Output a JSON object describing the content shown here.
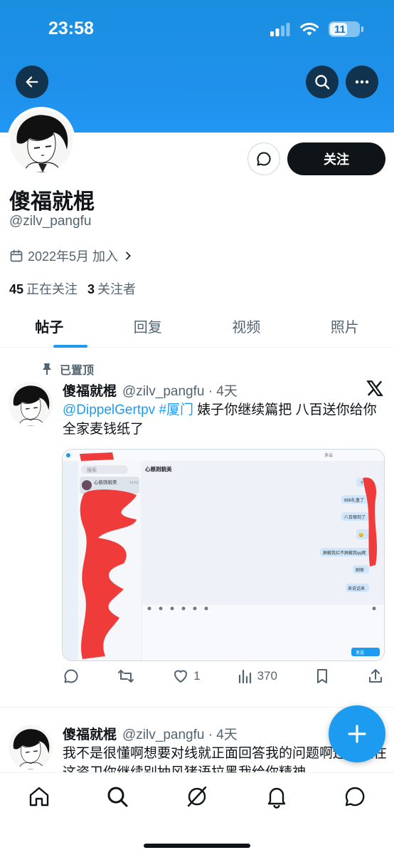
{
  "status_bar": {
    "time": "23:58",
    "battery": "11"
  },
  "profile": {
    "display_name": "傻福就棍",
    "handle": "@zilv_pangfu",
    "joined": "2022年5月 加入",
    "following_count": "45",
    "following_label": "正在关注",
    "followers_count": "3",
    "followers_label": "关注者",
    "follow_button": "关注"
  },
  "tabs": [
    {
      "label": "帖子",
      "active": true
    },
    {
      "label": "回复",
      "active": false
    },
    {
      "label": "视频",
      "active": false
    },
    {
      "label": "照片",
      "active": false
    }
  ],
  "posts": [
    {
      "pinned_label": "已置顶",
      "author": "傻福就棍",
      "meta": "@zilv_pangfu · 4天",
      "mention": "@DippelGertpv",
      "hashtag": "#厦门",
      "text": " 婊子你继续篇把 八百送你给你全家麦钱纸了",
      "likes": "1",
      "views": "370",
      "media": {
        "search_placeholder": "搜索",
        "chat_title": "心慈则貌美",
        "contact_name": "心慈则貌美",
        "contact_time": "14:52",
        "top_right": "多云",
        "messages": [
          "?",
          "666礼盒了",
          "八百哪到了",
          "😊",
          "屏蔽我拦不屏蔽我qq呢",
          "剧家",
          "来说话来"
        ],
        "send_label": "发送"
      }
    },
    {
      "author": "傻福就棍",
      "meta": "@zilv_pangfu · 4天",
      "text": "我不是很懂啊想要对线就正面回答我的问题啊还一直在这资卫你继续别抽风猪语拉黑我给你精神"
    }
  ],
  "colors": {
    "banner": "#1d8fe6",
    "accent": "#1d9bf0",
    "text": "#0f1419",
    "muted": "#536471"
  }
}
